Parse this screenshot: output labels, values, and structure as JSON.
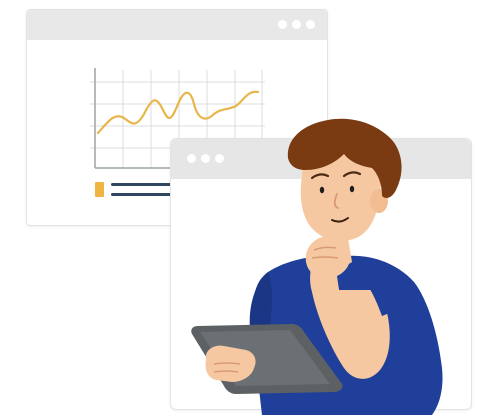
{
  "illustration": {
    "colors": {
      "background": "#ffffff",
      "window_bar": "#e8e8e8",
      "chart_line": "#e8b64b",
      "grid": "#d9d9d9",
      "shirt": "#1f3f9a",
      "hair": "#7a3b12",
      "skin": "#f6c8a2",
      "tablet": "#5d6164"
    },
    "back_window": {
      "window_control_icons": [
        "dot-icon",
        "dot-icon",
        "dot-icon"
      ]
    },
    "front_window": {
      "window_control_icons": [
        "dot-icon",
        "dot-icon",
        "dot-icon"
      ]
    }
  }
}
